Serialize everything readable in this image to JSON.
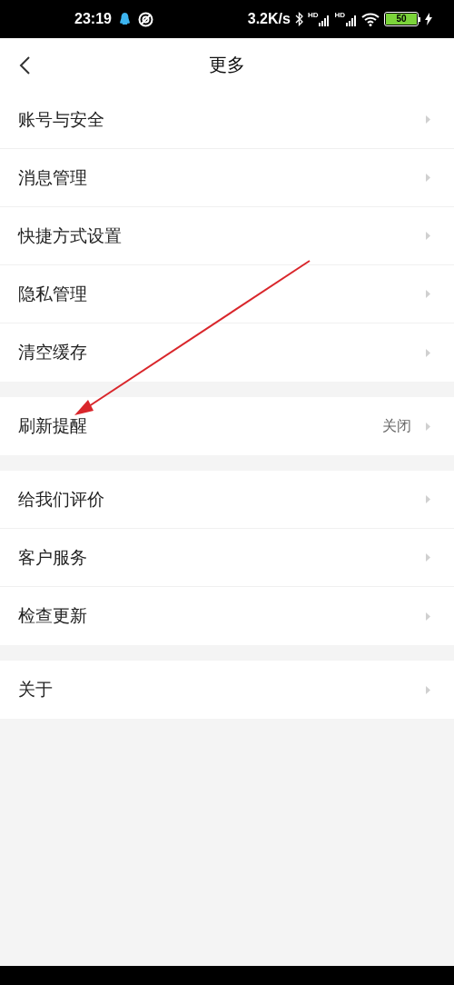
{
  "status_bar": {
    "time": "23:19",
    "network_speed": "3.2K/s",
    "signal_labels": [
      "HD",
      "HD"
    ],
    "battery": "50"
  },
  "header": {
    "title": "更多"
  },
  "groups": [
    {
      "items": [
        {
          "label": "账号与安全"
        },
        {
          "label": "消息管理"
        },
        {
          "label": "快捷方式设置"
        },
        {
          "label": "隐私管理"
        },
        {
          "label": "清空缓存"
        }
      ]
    },
    {
      "items": [
        {
          "label": "刷新提醒",
          "value": "关闭"
        }
      ]
    },
    {
      "items": [
        {
          "label": "给我们评价"
        },
        {
          "label": "客户服务"
        },
        {
          "label": "检查更新"
        }
      ]
    },
    {
      "items": [
        {
          "label": "关于"
        }
      ]
    }
  ]
}
